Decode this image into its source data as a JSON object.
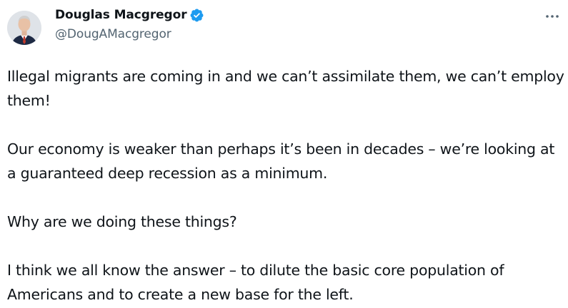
{
  "author": {
    "display_name": "Douglas Macgregor",
    "handle": "@DougAMacgregor",
    "verified": true,
    "verified_color": "#1d9bf0"
  },
  "icons": {
    "verified": "verified-badge-icon",
    "more": "more-options-icon"
  },
  "tweet": {
    "paragraphs": [
      "Illegal migrants are coming in and we can’t assimilate them, we can’t employ them!",
      "Our economy is weaker than perhaps it’s been in decades – we’re looking at a guaranteed deep recession as a minimum.",
      "Why are we doing these things?",
      "I think we all know the answer – to dilute the basic core population of Americans and to create a new base for the left."
    ]
  },
  "colors": {
    "text": "#0f1419",
    "secondary": "#536471",
    "background": "#ffffff"
  }
}
